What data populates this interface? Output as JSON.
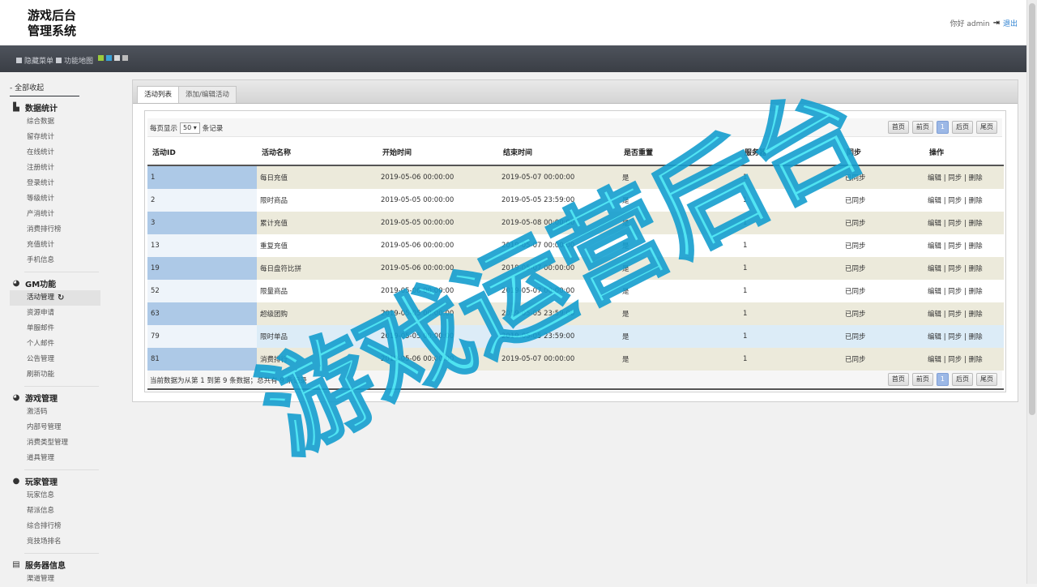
{
  "header": {
    "logo_line1": "游戏后台",
    "logo_line2": "管理系统",
    "greeting": "你好 admin",
    "logout": "退出"
  },
  "toolbar": {
    "hide_menu": "隐藏菜单",
    "func_map": "功能地图",
    "swatches": [
      "#9ccc3c",
      "#3aa3d8",
      "#d9d9d9",
      "#bcbcbc"
    ]
  },
  "sidebar": {
    "collapse_all": "- 全部收起",
    "groups": [
      {
        "title": "数据统计",
        "icon": "bar-chart-icon",
        "items": [
          "综合数据",
          "留存统计",
          "在线统计",
          "注册统计",
          "登录统计",
          "等级统计",
          "产消统计",
          "消费排行榜",
          "充值统计",
          "手机信息"
        ]
      },
      {
        "title": "GM功能",
        "icon": "gm-icon",
        "items": [
          "活动管理",
          "资源申请",
          "单服邮件",
          "个人邮件",
          "公告管理",
          "刷新功能"
        ]
      },
      {
        "title": "游戏管理",
        "icon": "game-icon",
        "items": [
          "激活码",
          "内部号管理",
          "消费类型管理",
          "道具管理"
        ]
      },
      {
        "title": "玩家管理",
        "icon": "user-icon",
        "items": [
          "玩家信息",
          "帮派信息",
          "综合排行榜",
          "竞技场排名"
        ]
      },
      {
        "title": "服务器信息",
        "icon": "server-icon",
        "items": [
          "渠道管理"
        ]
      }
    ]
  },
  "tabs": [
    "活动列表",
    "添加/编辑活动"
  ],
  "list": {
    "per_page_prefix": "每页显示",
    "per_page_value": "50",
    "per_page_suffix": "条记录",
    "pager": [
      "首页",
      "前页",
      "1",
      "后页",
      "尾页"
    ],
    "info": "当前数据为从第 1 到第 9 条数据；总共有 9 条记录",
    "columns": [
      "活动ID",
      "活动名称",
      "开始时间",
      "结束时间",
      "是否重置",
      "服务器",
      "同步",
      "操作"
    ],
    "rows": [
      [
        "1",
        "每日充值",
        "2019-05-06 00:00:00",
        "2019-05-07 00:00:00",
        "是",
        "1",
        "已同步"
      ],
      [
        "2",
        "限时商品",
        "2019-05-05 00:00:00",
        "2019-05-05 23:59:00",
        "是",
        "1",
        "已同步"
      ],
      [
        "3",
        "累计充值",
        "2019-05-05 00:00:00",
        "2019-05-08 00:00:00",
        "是",
        "1",
        "已同步"
      ],
      [
        "13",
        "重复充值",
        "2019-05-06 00:00:00",
        "2019-05-07 00:00:00",
        "是",
        "1",
        "已同步"
      ],
      [
        "19",
        "每日盘符比拼",
        "2019-05-06 00:00:00",
        "2019-05-07 00:00:00",
        "是",
        "1",
        "已同步"
      ],
      [
        "52",
        "限量商品",
        "2019-05-06 00:00:00",
        "2019-05-07 00:00:00",
        "是",
        "1",
        "已同步"
      ],
      [
        "63",
        "超级团购",
        "2019-05-05 00:00:00",
        "2019-05-05 23:59:00",
        "是",
        "1",
        "已同步"
      ],
      [
        "79",
        "限时单品",
        "2019-05-05 00:00:00",
        "2019-05-05 23:59:00",
        "是",
        "1",
        "已同步"
      ],
      [
        "81",
        "消费排行",
        "2019-05-06 00:00:00",
        "2019-05-07 00:00:00",
        "是",
        "1",
        "已同步"
      ]
    ],
    "ops": {
      "edit": "编辑",
      "sync": "同步",
      "del": "删除",
      "sep": "|"
    }
  },
  "watermark": "游戏运营后台"
}
